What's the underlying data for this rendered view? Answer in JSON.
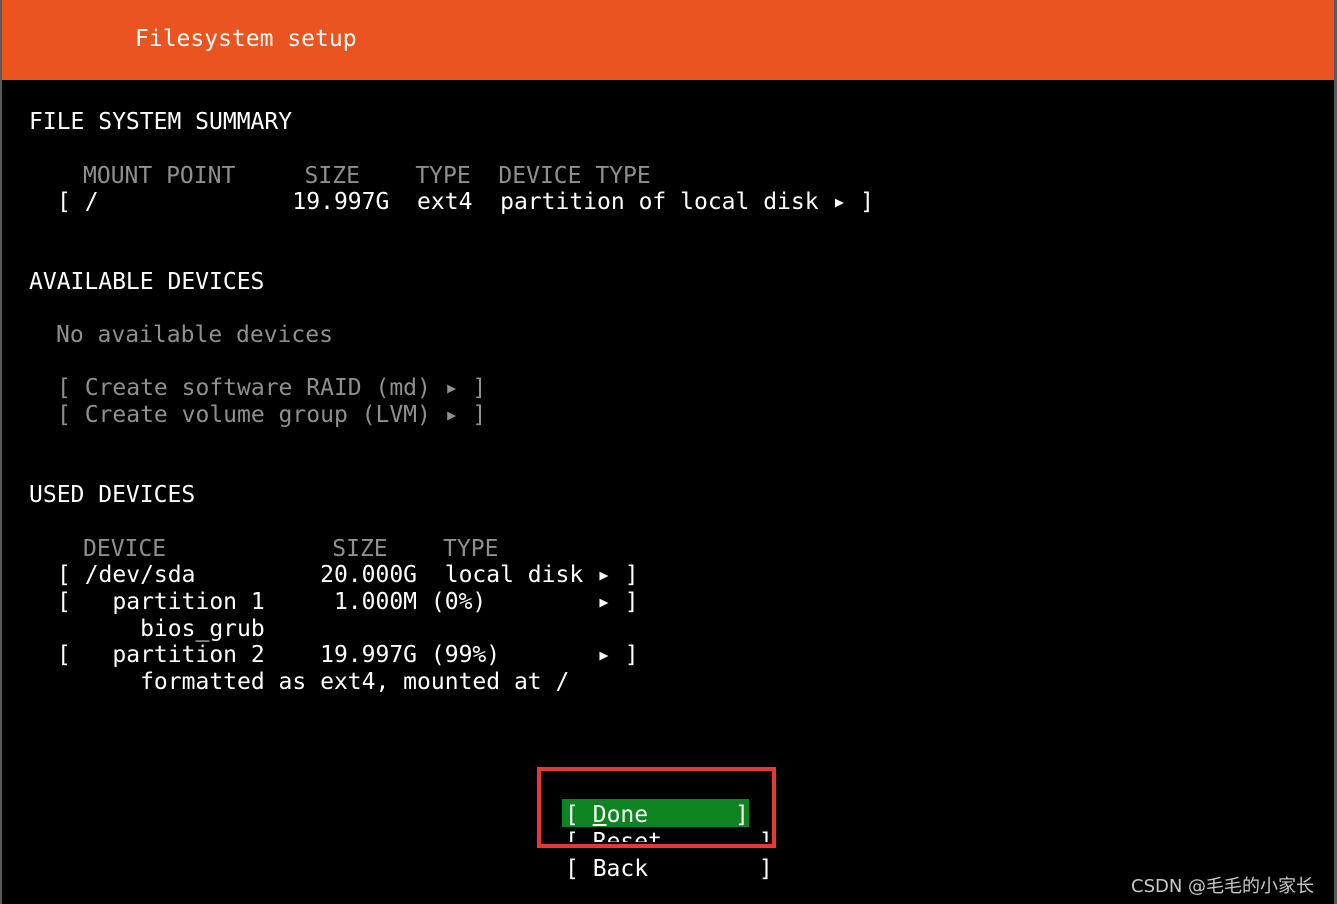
{
  "header": {
    "title": "Filesystem setup"
  },
  "summary": {
    "heading": "FILE SYSTEM SUMMARY",
    "columns": "MOUNT POINT     SIZE    TYPE  DEVICE TYPE",
    "rows": [
      "[ /              19.997G  ext4  partition of local disk ▸ ]"
    ]
  },
  "available": {
    "heading": "AVAILABLE DEVICES",
    "empty_text": "No available devices",
    "actions": [
      "[ Create software RAID (md) ▸ ]",
      "[ Create volume group (LVM) ▸ ]"
    ]
  },
  "used": {
    "heading": "USED DEVICES",
    "columns": "DEVICE            SIZE    TYPE",
    "rows": [
      "[ /dev/sda         20.000G  local disk ▸ ]",
      "[   partition 1     1.000M (0%)        ▸ ]",
      "      bios_grub",
      "[   partition 2    19.997G (99%)       ▸ ]",
      "      formatted as ext4, mounted at /"
    ]
  },
  "buttons": {
    "done": {
      "open": "[ ",
      "accel": "D",
      "rest": "one",
      "close": "]"
    },
    "reset": "[ Reset       ]",
    "back": "[ Back        ]"
  },
  "watermark": "CSDN @毛毛的小家长",
  "colors": {
    "header_bg": "#e95420",
    "button_focus_bg": "#0e8420",
    "annotation_box": "#e53935"
  }
}
